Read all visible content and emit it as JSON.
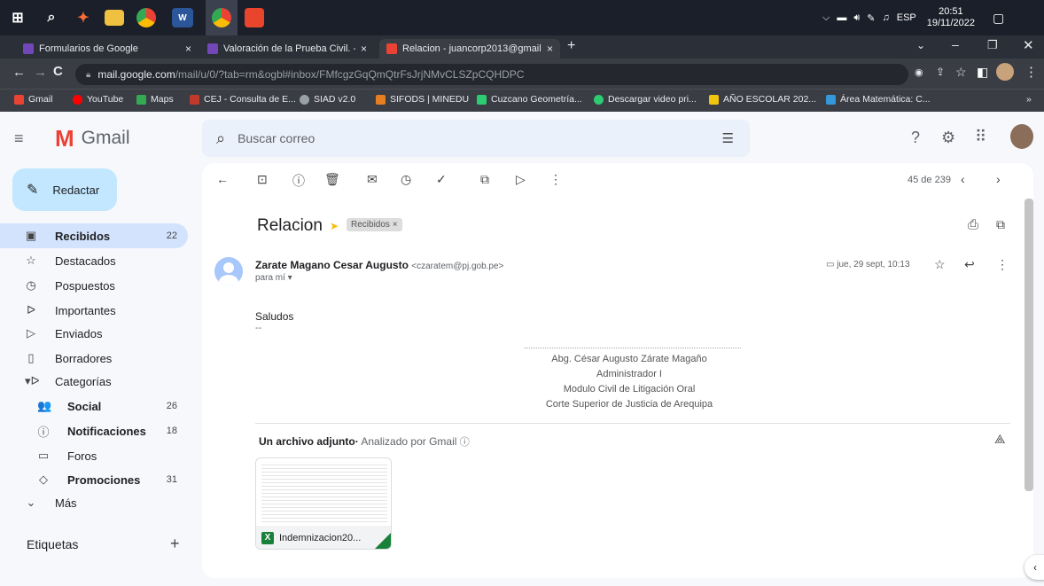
{
  "taskbar": {
    "icons": [
      "windows-start-icon",
      "search-icon",
      "app-icon",
      "file-explorer-icon",
      "chrome-icon",
      "word-icon",
      "chrome-active-icon",
      "app-red-icon"
    ],
    "tray": {
      "lang": "ESP",
      "time": "20:51",
      "date": "19/11/2022"
    }
  },
  "tabs": [
    {
      "title": "Formularios de Google",
      "color": "#7248b9"
    },
    {
      "title": "Valoración de la Prueba Civil. - Fo",
      "color": "#7248b9"
    },
    {
      "title": "Relacion - juancorp2013@gmail.",
      "color": "#ea4335"
    }
  ],
  "new_tab": "+",
  "address": {
    "url_main": "mail.google.com",
    "url_rest": "/mail/u/0/?tab=rm&ogbl#inbox/FMfcgzGqQmQtrFsJrjNMvCLSZpCQHDPC"
  },
  "bookmarks": [
    {
      "label": "Gmail",
      "color": "#ea4335"
    },
    {
      "label": "YouTube",
      "color": "#ff0000"
    },
    {
      "label": "Maps",
      "color": "#34a853"
    },
    {
      "label": "CEJ - Consulta de E...",
      "color": "#c0392b"
    },
    {
      "label": "SIAD v2.0",
      "color": "#9aa0a6"
    },
    {
      "label": "SIFODS | MINEDU",
      "color": "#e67e22"
    },
    {
      "label": "Cuzcano Geometría...",
      "color": "#2ecc71"
    },
    {
      "label": "Descargar video pri...",
      "color": "#2ecc71"
    },
    {
      "label": "AÑO ESCOLAR 202...",
      "color": "#f1c40f"
    },
    {
      "label": "Área Matemática: C...",
      "color": "#3498db"
    }
  ],
  "gmail": {
    "logo": "Gmail",
    "search_placeholder": "Buscar correo",
    "compose": "Redactar"
  },
  "nav": [
    {
      "label": "Recibidos",
      "count": "22",
      "icon": "inbox-icon",
      "glyph": "▣",
      "bold": true,
      "active": true
    },
    {
      "label": "Destacados",
      "count": "",
      "icon": "star-icon",
      "glyph": "☆"
    },
    {
      "label": "Pospuestos",
      "count": "",
      "icon": "clock-icon",
      "glyph": "◷"
    },
    {
      "label": "Importantes",
      "count": "",
      "icon": "important-icon",
      "glyph": "ᐅ"
    },
    {
      "label": "Enviados",
      "count": "",
      "icon": "send-icon",
      "glyph": "▷"
    },
    {
      "label": "Borradores",
      "count": "",
      "icon": "draft-icon",
      "glyph": "▯"
    },
    {
      "label": "Categorías",
      "count": "",
      "icon": "label-icon",
      "glyph": "▾ᐅ"
    },
    {
      "label": "Social",
      "count": "26",
      "icon": "people-icon",
      "glyph": "👥",
      "bold": true,
      "sub": true
    },
    {
      "label": "Notificaciones",
      "count": "18",
      "icon": "info-icon",
      "glyph": "ⓘ",
      "bold": true,
      "sub": true
    },
    {
      "label": "Foros",
      "count": "",
      "icon": "forum-icon",
      "glyph": "▭",
      "sub": true
    },
    {
      "label": "Promociones",
      "count": "31",
      "icon": "tag-icon",
      "glyph": "◇",
      "bold": true,
      "sub": true
    },
    {
      "label": "Más",
      "count": "",
      "icon": "expand-icon",
      "glyph": "⌄"
    }
  ],
  "labels_heading": "Etiquetas",
  "labels_add": "+",
  "toolbar": {
    "pager": "45 de 239"
  },
  "email": {
    "subject": "Relacion",
    "label_chip": "Recibidos ×",
    "sender_name": "Zarate Magano Cesar Augusto",
    "sender_email": "<czaratem@pj.gob.pe>",
    "to": "para mí ▾",
    "date": "jue, 29 sept, 10:13",
    "body_greeting": "Saludos",
    "body_dash": "--",
    "signature": [
      "Abg. César Augusto Zárate Magaño",
      "Administrador I",
      "Modulo Civil de Litigación Oral",
      "Corte Superior de Justicia de Arequipa"
    ],
    "attachments_title": "Un archivo adjunto",
    "attachments_scan": "Analizado por Gmail",
    "attachment_name": "Indemnizacion20...",
    "attachment_badge": "X"
  }
}
